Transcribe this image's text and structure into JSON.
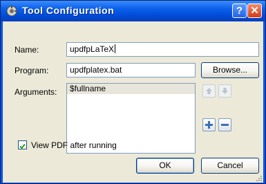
{
  "window": {
    "title": "Tool Configuration",
    "help_label": "?",
    "close_label": "✕"
  },
  "form": {
    "name_label": "Name:",
    "name_value": "updfpLaTeX",
    "program_label": "Program:",
    "program_value": "updfplatex.bat",
    "browse_label": "Browse...",
    "arguments_label": "Arguments:",
    "arguments": [
      "$fullname"
    ],
    "view_pdf_label": "View PDF after running",
    "view_pdf_checked": true
  },
  "buttons": {
    "ok_label": "OK",
    "cancel_label": "Cancel"
  },
  "icons": {
    "app": "tool-icon",
    "move_up": "arrow-up-icon",
    "move_down": "arrow-down-icon",
    "add": "plus-icon",
    "remove": "minus-icon"
  }
}
